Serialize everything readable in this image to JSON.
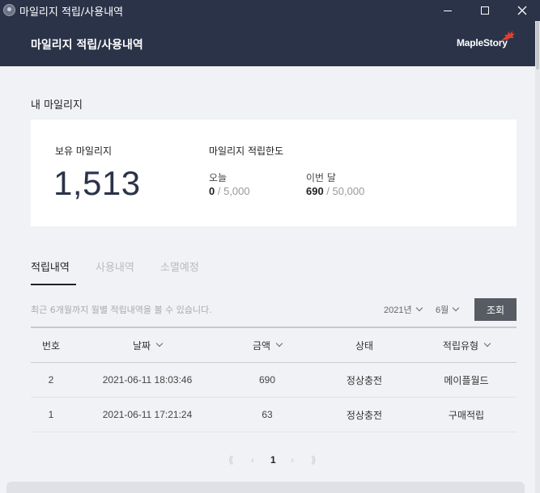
{
  "window": {
    "title": "마일리지 적립/사용내역"
  },
  "header": {
    "title": "마일리지 적립/사용내역",
    "logo_text": "MapleStory"
  },
  "my_mileage": {
    "section_title": "내 마일리지",
    "balance_label": "보유 마일리지",
    "balance_value": "1,513",
    "limit_label": "마일리지 적립한도",
    "today_label": "오늘",
    "today_used": "0",
    "today_limit": "/ 5,000",
    "month_label": "이번 달",
    "month_used": "690",
    "month_limit": "/ 50,000"
  },
  "tabs": [
    {
      "label": "적립내역",
      "active": true
    },
    {
      "label": "사용내역",
      "active": false
    },
    {
      "label": "소멸예정",
      "active": false
    }
  ],
  "filter": {
    "notice": "최근 6개월까지 월별 적립내역을 볼 수 있습니다.",
    "year": "2021년",
    "month": "6월",
    "search_label": "조회"
  },
  "table": {
    "headers": [
      "번호",
      "날짜",
      "금액",
      "상태",
      "적립유형"
    ],
    "rows": [
      {
        "no": "2",
        "date": "2021-06-11 18:03:46",
        "amount": "690",
        "status": "정상충전",
        "type": "메이플월드"
      },
      {
        "no": "1",
        "date": "2021-06-11 17:21:24",
        "amount": "63",
        "status": "정상충전",
        "type": "구매적립"
      }
    ]
  },
  "pagination": {
    "first": "⟪",
    "prev": "‹",
    "current": "1",
    "next": "›",
    "last": "⟫"
  },
  "colors": {
    "header_bg": "#2b3348",
    "accent": "#2b3348",
    "button_bg": "#575b64"
  }
}
